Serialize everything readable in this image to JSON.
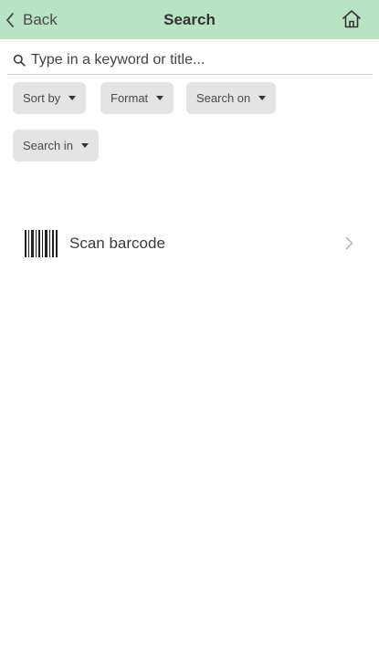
{
  "header": {
    "back_label": "Back",
    "title": "Search",
    "background_color": "#b9e4c4"
  },
  "search": {
    "placeholder": "Type in a keyword or title...",
    "value": ""
  },
  "filters": [
    {
      "label": "Sort by",
      "icon": "caret-down-icon"
    },
    {
      "label": "Format",
      "icon": "caret-down-icon"
    },
    {
      "label": "Search on",
      "icon": "caret-down-icon"
    },
    {
      "label": "Search in",
      "icon": "caret-down-icon"
    }
  ],
  "scan": {
    "label": "Scan barcode",
    "icon": "barcode-icon",
    "chevron": "chevron-right-icon"
  }
}
